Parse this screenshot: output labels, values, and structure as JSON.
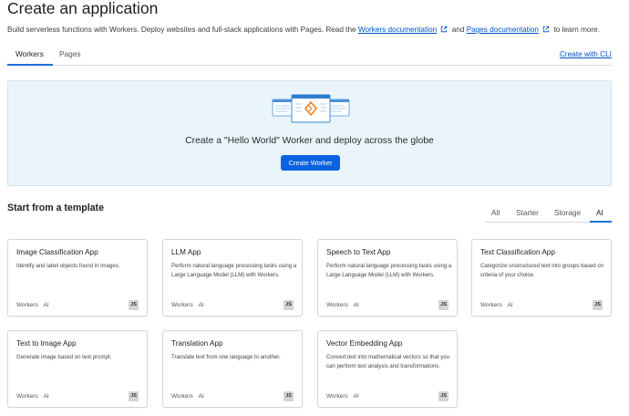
{
  "header": {
    "title": "Create an application",
    "subtitle_pre": "Build serverless functions with Workers. Deploy websites and full-stack applications with Pages. Read the",
    "workers_doc_link": "Workers documentation",
    "subtitle_mid": "and",
    "pages_doc_link": "Pages documentation",
    "subtitle_post": "to learn more."
  },
  "tabs": [
    {
      "label": "Workers",
      "active": true
    },
    {
      "label": "Pages",
      "active": false
    }
  ],
  "cli_link": "Create with CLI",
  "hero": {
    "text": "Create a \"Hello World\" Worker and deploy across the globe",
    "button": "Create Worker"
  },
  "templates": {
    "title": "Start from a template",
    "filters": [
      {
        "label": "All",
        "active": false
      },
      {
        "label": "Starter",
        "active": false
      },
      {
        "label": "Storage",
        "active": false
      },
      {
        "label": "AI",
        "active": true
      }
    ],
    "cards": [
      {
        "title": "Image Classification App",
        "desc": "Identify and label objects found in images.",
        "tags": [
          "Workers",
          "AI"
        ],
        "badge": "JS"
      },
      {
        "title": "LLM App",
        "desc": "Perform natural language processing tasks using a Large Language Model (LLM) with Workers.",
        "tags": [
          "Workers",
          "AI"
        ],
        "badge": "JS"
      },
      {
        "title": "Speech to Text App",
        "desc": "Perform natural language processing tasks using a Large Language Model (LLM) with Workers.",
        "tags": [
          "Workers",
          "AI"
        ],
        "badge": "JS"
      },
      {
        "title": "Text Classification App",
        "desc": "Categorize unstructured text into groups based on criteria of your choice.",
        "tags": [
          "Workers",
          "AI"
        ],
        "badge": "JS"
      },
      {
        "title": "Text to Image App",
        "desc": "Generate image based on text prompt.",
        "tags": [
          "Workers",
          "AI"
        ],
        "badge": "JS"
      },
      {
        "title": "Translation App",
        "desc": "Translate text from one language to another.",
        "tags": [
          "Workers",
          "AI"
        ],
        "badge": "JS"
      },
      {
        "title": "Vector Embedding App",
        "desc": "Convert text into mathematical vectors so that you can perform text analysis and transformations.",
        "tags": [
          "Workers",
          "AI"
        ],
        "badge": "JS"
      }
    ]
  },
  "colors": {
    "accent": "#0b62e0",
    "link": "#0051c3",
    "hero_bg": "#e9f5fa"
  }
}
